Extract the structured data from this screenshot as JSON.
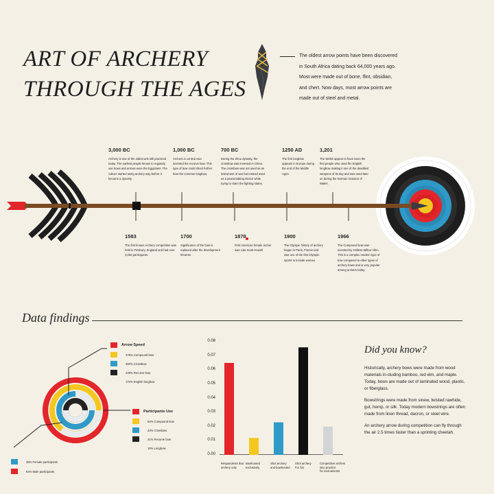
{
  "title": {
    "line1": "ART OF ARCHERY",
    "line2": "THROUGH THE AGES"
  },
  "intro": "The oldest arrow points have been discovered in South Africa dating back 64,000 years ago. Most were made out of bone, flint, obsidian, and chert. Now days, most arrow points are made out of steel and metal.",
  "colors": {
    "background": "#f5f0e6",
    "red": "#e2262b",
    "yellow": "#f4c721",
    "blue": "#2f9ac8",
    "black": "#222222",
    "grey": "#d3d4d6",
    "wood": "#7a4a22"
  },
  "timeline_top": [
    {
      "year": "3,000 BC",
      "text": "Archery is one of the oldest arts still practiced today. The earliest people known to regularly use bows and arrows were the Egyptians. The culture started using archery way before it became a dynasty."
    },
    {
      "year": "1,000 BC",
      "text": "Archers in central Asia invented the recurve bow. This type of bow could shoot further than the common longbow."
    },
    {
      "year": "700 BC",
      "text": "During the Zhou dynasty, the crossbow was invented in China. The crossbow was not used as an instrument of war but instead used as a peacemaking device while trying to claim the fighting states."
    },
    {
      "year": "1250 AD",
      "text": "The first longbow appears in Europe during the end of the Middle Ages."
    },
    {
      "year": "1,201",
      "text": "The Welsh appear to have been the first people who used the English longbow making it one of the deadliest weapons of its day and was used later on during the Norman invasion of Wales."
    }
  ],
  "timeline_bottom": [
    {
      "year": "1583",
      "text": "The first known Archery competition was held in Finsbury, England and had over 3,000 participants."
    },
    {
      "year": "1700",
      "text": "Significance of the bow is replaced after the development firearms"
    },
    {
      "year": "1878",
      "text": "First American female archer was Lida Scott Howell"
    },
    {
      "year": "1900",
      "text": "The Olympic history of archery began in Paris, France and was one of the first Olympic sports to include women."
    },
    {
      "year": "1966",
      "text": "The Compound bow was invented by Holless Wilbur Allen. This is a complex modern type of bow compared to other types of archery bows and is very popular among archers today."
    }
  ],
  "data_findings": {
    "title": "Data findings"
  },
  "arrow_speed": {
    "title": "Arrow Speed",
    "items": [
      {
        "label": "378% Compound bow",
        "color": "#f4c721"
      },
      {
        "label": "460% Crossbow",
        "color": "#2f9ac8"
      },
      {
        "label": "228% Recurve bow",
        "color": "#222222"
      },
      {
        "label": "172% English longbow",
        "color": "#e2262b"
      }
    ]
  },
  "participants_use": {
    "title": "Participants Use",
    "items": [
      {
        "label": "62% Compound bow",
        "color": "#f4c721"
      },
      {
        "label": "22% Crossbow",
        "color": "#2f9ac8"
      },
      {
        "label": "21% Recurve bow",
        "color": "#222222"
      },
      {
        "label": "15% Longbow",
        "color": "#e2262b"
      }
    ]
  },
  "gender": {
    "items": [
      {
        "label": "36% Female participants",
        "color": "#2f9ac8"
      },
      {
        "label": "64% Male participants",
        "color": "#e2262b"
      }
    ]
  },
  "chart_data": {
    "type": "bar",
    "categories": [
      "Respondents that archery only",
      "Bowhunted exclusively",
      "Shot archery and bowhunted",
      "Shot archery For fun",
      "Competitive archers who practice for tournaments"
    ],
    "category_lines": [
      [
        "Respondents that",
        "archery only"
      ],
      [
        "Bowhunted",
        "exclusively"
      ],
      [
        "Shot archery",
        "and bowhunted"
      ],
      [
        "Shot archery",
        "For fun"
      ],
      [
        "Competitive archers",
        "who practice",
        "for tournaments"
      ]
    ],
    "values": [
      0.065,
      0.012,
      0.023,
      0.076,
      0.02
    ],
    "colors": [
      "#e2262b",
      "#f4c721",
      "#2f9ac8",
      "#111111",
      "#d3d4d6"
    ],
    "yticks": [
      "0.08",
      "0.07",
      "0.06",
      "0.05",
      "0.04",
      "0.03",
      "0.02",
      "0.01",
      "0.00"
    ],
    "ylim": [
      0,
      0.08
    ],
    "title": "",
    "xlabel": "",
    "ylabel": ""
  },
  "did_you_know": {
    "title": "Did you know?",
    "paragraphs": [
      "Historically, archery bows were made from wood materials in-cluding bamboo, red elm, and maple. Today, bows are made out of laminated wood, plastic, or fiberglass.",
      "Bowstrings were made from sinew, twisted rawhide, gut, hemp, or silk. Today modern bowstrings are often made from linen thread, dacron, or steel wire.",
      "An archery arrow during competition can fly through the air 2.5 times faster than a sprinting cheetah."
    ]
  }
}
